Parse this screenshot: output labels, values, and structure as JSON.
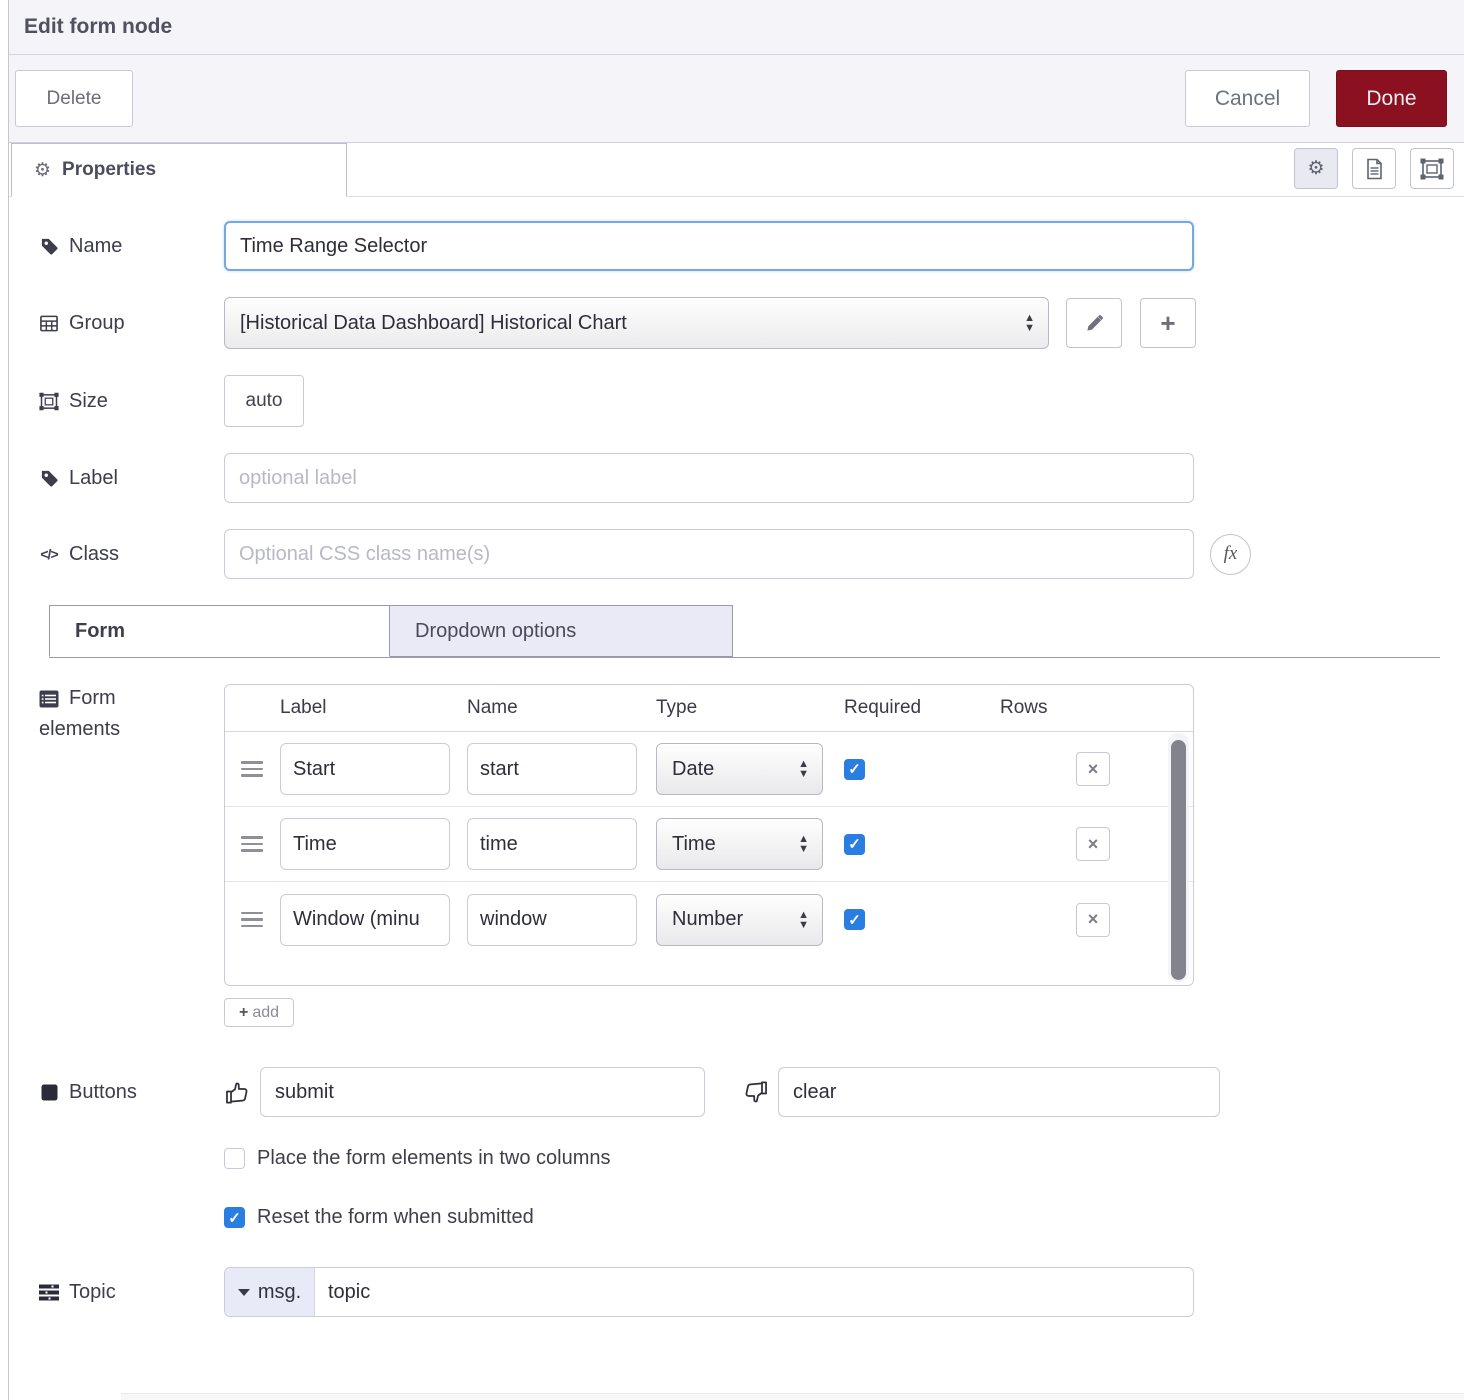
{
  "dialog": {
    "title": "Edit form node"
  },
  "toolbar": {
    "delete_label": "Delete",
    "cancel_label": "Cancel",
    "done_label": "Done"
  },
  "properties_tab": {
    "label": "Properties"
  },
  "fields": {
    "name": {
      "label": "Name",
      "value": "Time Range Selector"
    },
    "group": {
      "label": "Group",
      "value": "[Historical Data Dashboard] Historical Chart"
    },
    "size": {
      "label": "Size",
      "value": "auto"
    },
    "label": {
      "label": "Label",
      "value": "",
      "placeholder": "optional label"
    },
    "class": {
      "label": "Class",
      "value": "",
      "placeholder": "Optional CSS class name(s)",
      "fx_label": "fx"
    }
  },
  "section_tabs": {
    "form": "Form",
    "dropdown": "Dropdown options"
  },
  "form_elements": {
    "label_line1": "Form",
    "label_line2": "elements",
    "headers": [
      "Label",
      "Name",
      "Type",
      "Required",
      "Rows"
    ],
    "rows": [
      {
        "label": "Start",
        "name": "start",
        "type": "Date",
        "required": true
      },
      {
        "label": "Time",
        "name": "time",
        "type": "Time",
        "required": true
      },
      {
        "label": "Window (minu",
        "name": "window",
        "type": "Number",
        "required": true
      }
    ],
    "add_label": "add",
    "delete_glyph": "×",
    "check_glyph": "✓"
  },
  "buttons_row": {
    "label": "Buttons",
    "submit_value": "submit",
    "clear_value": "clear"
  },
  "options": {
    "two_columns": {
      "label": "Place the form elements in two columns",
      "checked": false
    },
    "reset": {
      "label": "Reset the form when submitted",
      "checked": true
    }
  },
  "topic": {
    "label": "Topic",
    "prefix": "msg.",
    "value": "topic"
  },
  "colors": {
    "done_red": "#8c1120",
    "checkbox_blue": "#2a7de1",
    "focus_blue": "#74a8e0"
  }
}
